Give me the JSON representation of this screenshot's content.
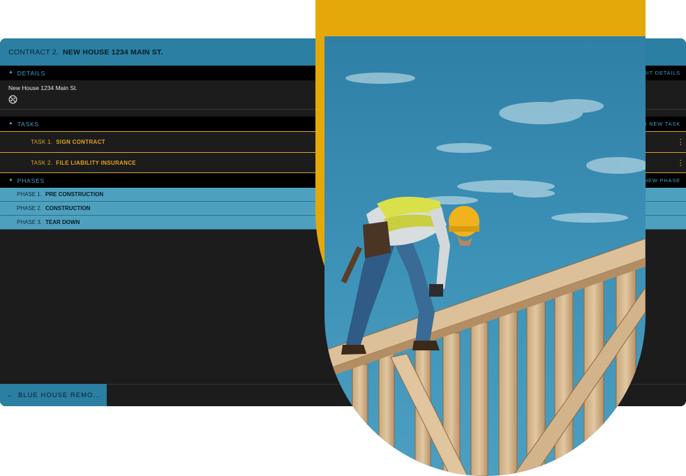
{
  "header": {
    "prefix": "CONTRACT 2.",
    "name": "NEW HOUSE 1234 MAIN ST."
  },
  "details": {
    "heading": "DETAILS",
    "action": "DIT DETAILS",
    "address": "New House 1234 Main St.",
    "icon": "no-link-icon"
  },
  "tasks": {
    "heading": "TASKS",
    "action": "D NEW TASK",
    "items": [
      {
        "num": "TASK 1.",
        "title": "SIGN CONTRACT"
      },
      {
        "num": "TASK 2.",
        "title": "FILE LIABILITY INSURANCE"
      }
    ]
  },
  "phases": {
    "heading": "PHASES",
    "action": "NEW PHASE",
    "items": [
      {
        "num": "PHASE 1.",
        "title": "PRE CONSTRUCTION"
      },
      {
        "num": "PHASE 2.",
        "title": "CONSTRUCTION"
      },
      {
        "num": "PHASE 3.",
        "title": "TEAR DOWN"
      }
    ]
  },
  "footer": {
    "back_label": "BLUE HOUSE REMO..."
  },
  "colors": {
    "accent_blue": "#2a7fa3",
    "phase_blue": "#4ea1be",
    "task_gold": "#e0a224",
    "card_yellow": "#e5a80a",
    "background": "#1c1c1c"
  },
  "photo": {
    "subject": "construction-worker-on-roof-frame"
  }
}
